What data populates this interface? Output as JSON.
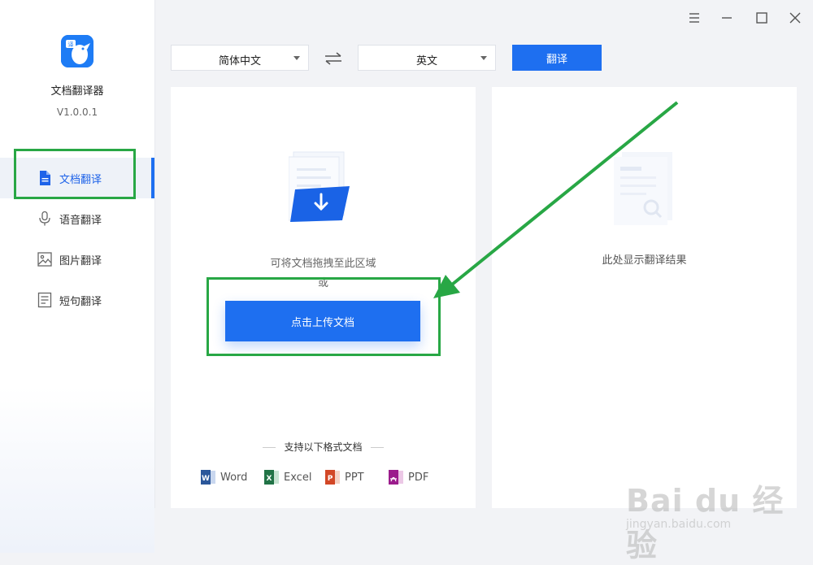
{
  "app": {
    "name": "文档翻译器",
    "version": "V1.0.0.1"
  },
  "sidebar": {
    "items": [
      {
        "label": "文档翻译",
        "icon": "document-icon",
        "active": true
      },
      {
        "label": "语音翻译",
        "icon": "microphone-icon",
        "active": false
      },
      {
        "label": "图片翻译",
        "icon": "image-icon",
        "active": false
      },
      {
        "label": "短句翻译",
        "icon": "text-list-icon",
        "active": false
      }
    ]
  },
  "toolbar": {
    "source_language": "简体中文",
    "target_language": "英文",
    "translate_label": "翻译"
  },
  "left_panel": {
    "drop_hint": "可将文档拖拽至此区域",
    "drop_hint_or": "或",
    "upload_label": "点击上传文档",
    "formats_title": "支持以下格式文档",
    "formats": [
      {
        "label": "Word",
        "color": "#2b579a"
      },
      {
        "label": "Excel",
        "color": "#217346"
      },
      {
        "label": "PPT",
        "color": "#d24726"
      },
      {
        "label": "PDF",
        "color": "#9b1c8c"
      }
    ]
  },
  "right_panel": {
    "result_hint": "此处显示翻译结果"
  },
  "colors": {
    "accent": "#1e6ff0",
    "annotation": "#28a745"
  },
  "watermark": {
    "main": "Bai du 经验",
    "sub": "jingyan.baidu.com"
  }
}
